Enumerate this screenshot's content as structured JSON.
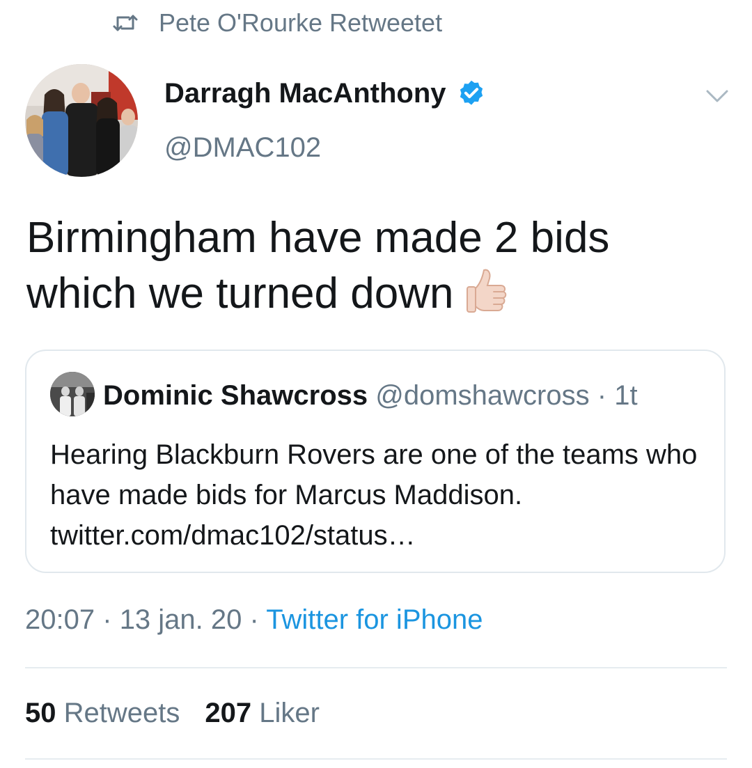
{
  "retweet": {
    "icon": "retweet-icon",
    "text": "Pete O'Rourke Retweetet"
  },
  "author": {
    "name": "Darragh MacAnthony",
    "handle": "@DMAC102",
    "verified_icon": "verified-badge-icon",
    "verified_color": "#1da1f2"
  },
  "tweet": {
    "text": "Birmingham have made 2 bids which we turned down",
    "emoji": "thumbs-up-icon"
  },
  "quote": {
    "name": "Dominic Shawcross",
    "handle": "@domshawcross",
    "separator": "·",
    "time": "1t",
    "text": "Hearing Blackburn Rovers are one of the teams who have made bids for Marcus Maddison. twitter.com/dmac102/status…"
  },
  "meta": {
    "time": "20:07",
    "sep1": "·",
    "date": "13 jan. 20",
    "sep2": "·",
    "source": "Twitter for iPhone",
    "source_color": "#1b95e0"
  },
  "stats": {
    "retweets_count": "50",
    "retweets_label": "Retweets",
    "likes_count": "207",
    "likes_label": "Liker"
  },
  "colors": {
    "text_primary": "#14171a",
    "text_secondary": "#657786",
    "divider": "#e6ecf0"
  }
}
